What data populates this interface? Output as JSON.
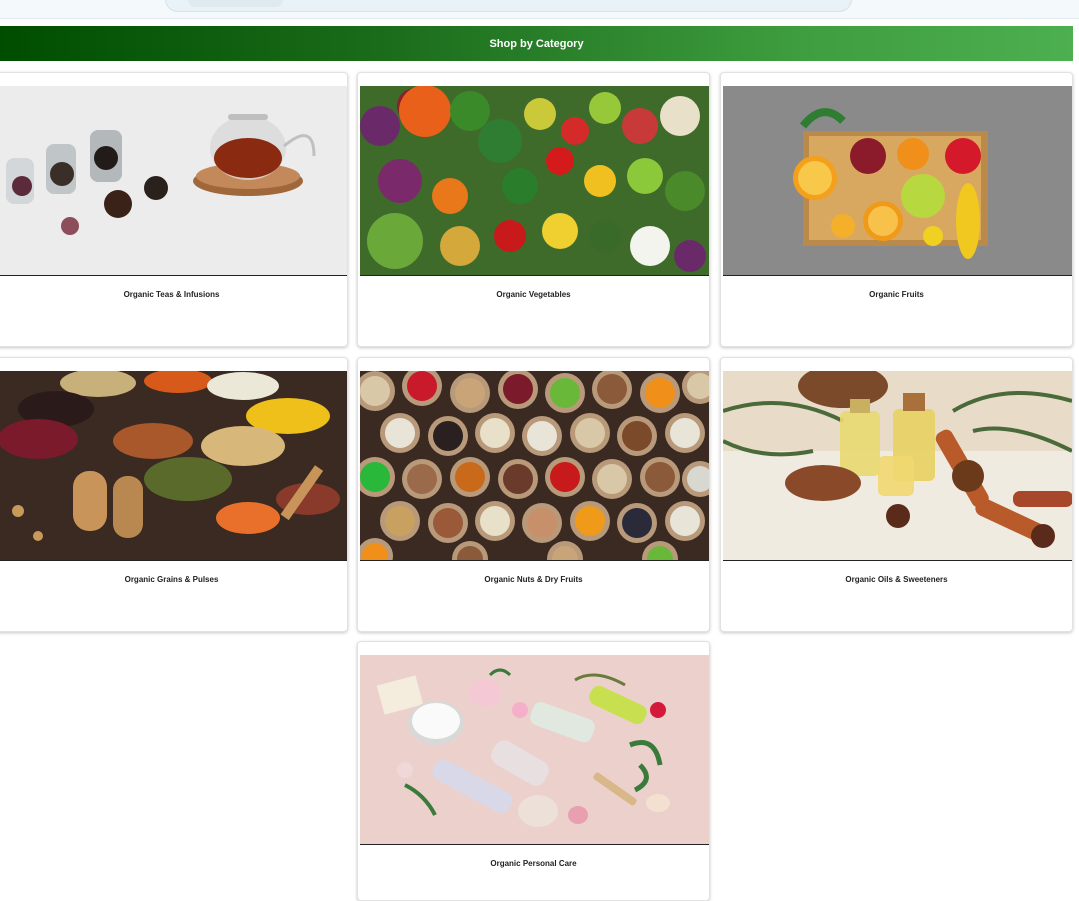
{
  "section": {
    "title": "Shop by Category"
  },
  "categories": [
    {
      "label": "Organic Teas & Infusions"
    },
    {
      "label": "Organic Vegetables"
    },
    {
      "label": "Organic Fruits"
    },
    {
      "label": "Organic Grains & Pulses"
    },
    {
      "label": "Organic Nuts & Dry Fruits"
    },
    {
      "label": "Organic Oils & Sweeteners"
    },
    {
      "label": "Organic Personal Care"
    }
  ],
  "colors": {
    "banner_start": "#004d00",
    "banner_end": "#4caf50",
    "label_text": "#222222"
  }
}
